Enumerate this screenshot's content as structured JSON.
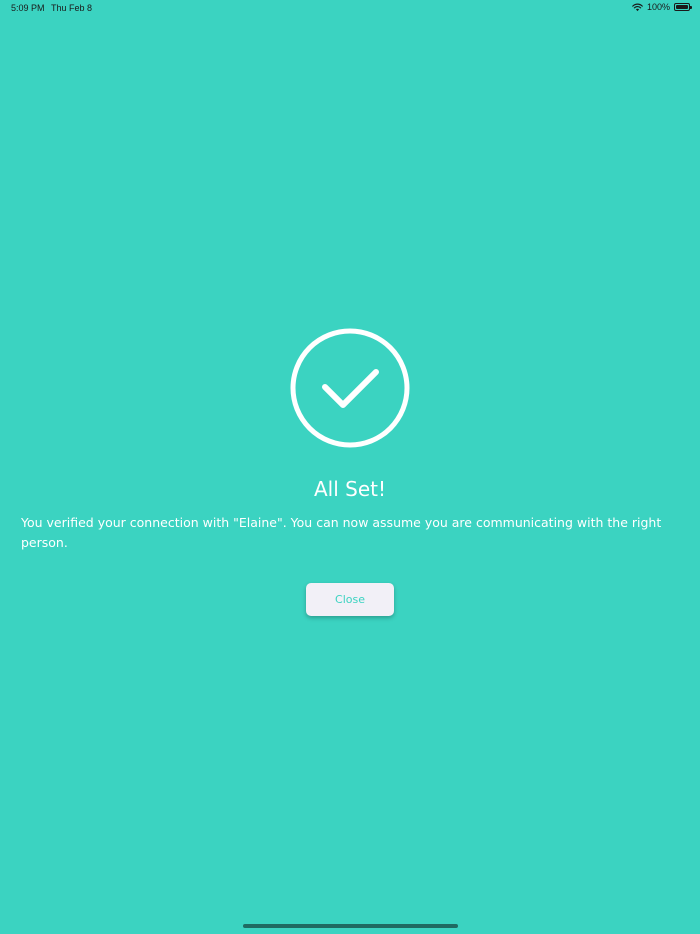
{
  "status_bar": {
    "time": "5:09 PM",
    "date": "Thu Feb 8",
    "battery": "100%"
  },
  "icons": {
    "success": "checkmark-circle-icon",
    "wifi": "wifi-icon",
    "battery": "battery-icon"
  },
  "colors": {
    "background": "#3bd3c1",
    "button_background": "#f2f0f7",
    "button_text": "#3bd3c1",
    "text": "#ffffff"
  },
  "main": {
    "title": "All Set!",
    "message": "You verified your connection with \"Elaine\". You can now assume you are communicating with the right person.",
    "close_label": "Close"
  }
}
